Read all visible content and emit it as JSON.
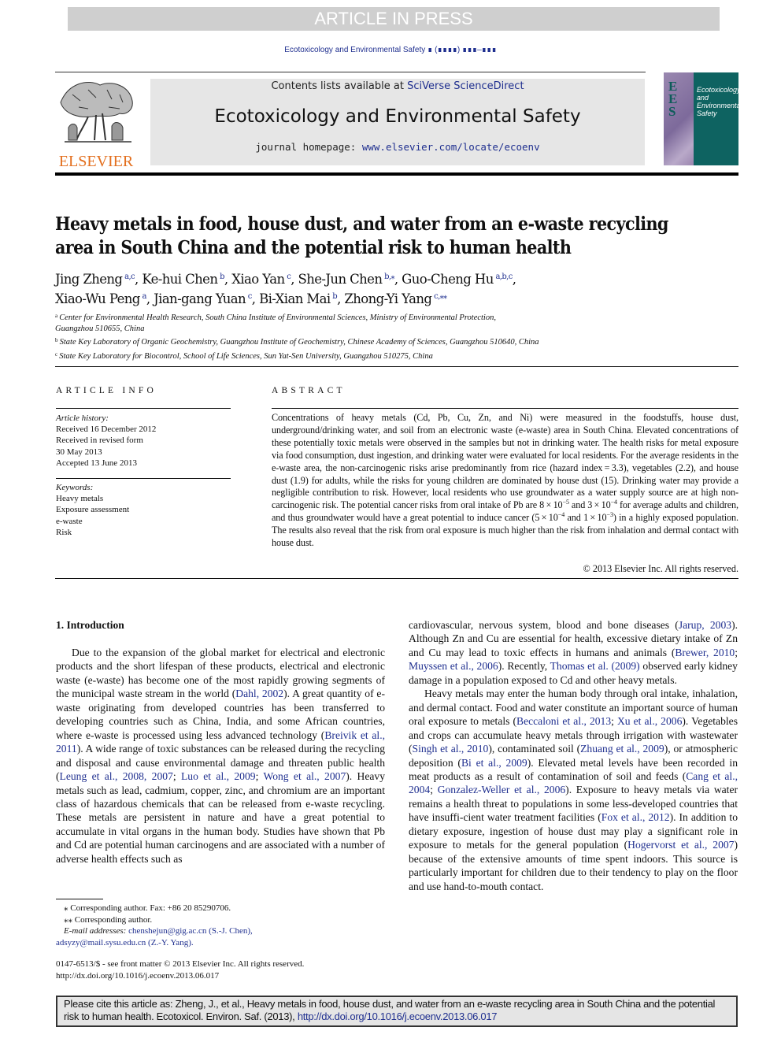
{
  "banner": {
    "text": "ARTICLE IN PRESS"
  },
  "running_head": {
    "text": "Ecotoxicology and Environmental Safety ∎ (∎∎∎∎) ∎∎∎–∎∎∎"
  },
  "publisher": {
    "wordmark": "ELSEVIER"
  },
  "masthead": {
    "contents_prefix": "Contents lists available at ",
    "contents_link": "SciVerse ScienceDirect",
    "journal_title": "Ecotoxicology and Environmental Safety",
    "homepage_prefix": "journal homepage: ",
    "homepage_link": "www.elsevier.com/locate/ecoenv"
  },
  "cover": {
    "letters": [
      "E",
      "E",
      "S"
    ],
    "title_lines": [
      "Ecotoxicology",
      "and",
      "Environmental",
      "Safety"
    ]
  },
  "article": {
    "title_line1": "Heavy metals in food, house dust, and water from an e-waste recycling",
    "title_line2": "area in South China and the potential risk to human health",
    "authors": [
      {
        "name": "Jing Zheng",
        "aff": "a,c"
      },
      {
        "name": "Ke-hui Chen",
        "aff": "b"
      },
      {
        "name": "Xiao Yan",
        "aff": "c"
      },
      {
        "name": "She-Jun Chen",
        "aff": "b,⁎"
      },
      {
        "name": "Guo-Cheng Hu",
        "aff": "a,b,c"
      },
      {
        "name": "Xiao-Wu Peng",
        "aff": "a"
      },
      {
        "name": "Jian-gang Yuan",
        "aff": "c"
      },
      {
        "name": "Bi-Xian Mai",
        "aff": "b"
      },
      {
        "name": "Zhong-Yi Yang",
        "aff": "c,⁎⁎"
      }
    ],
    "affiliations": [
      {
        "key": "a",
        "text_line1": "Center for Environmental Health Research, South China Institute of Environmental Sciences, Ministry of Environmental Protection,",
        "text_line2": "Guangzhou 510655, China"
      },
      {
        "key": "b",
        "text_line1": "State Key Laboratory of Organic Geochemistry, Guangzhou Institute of Geochemistry, Chinese Academy of Sciences, Guangzhou 510640, China"
      },
      {
        "key": "c",
        "text_line1": "State Key Laboratory for Biocontrol, School of Life Sciences, Sun Yat-Sen University, Guangzhou 510275, China"
      }
    ]
  },
  "article_info": {
    "heading": "ARTICLE INFO",
    "history_label": "Article history:",
    "history": [
      "Received 16 December 2012",
      "Received in revised form",
      "30 May 2013",
      "Accepted 13 June 2013"
    ],
    "keywords_label": "Keywords:",
    "keywords": [
      "Heavy metals",
      "Exposure assessment",
      "e-waste",
      "Risk"
    ]
  },
  "abstract": {
    "heading": "ABSTRACT",
    "part1": "Concentrations of heavy metals (Cd, Pb, Cu, Zn, and Ni) were measured in the foodstuffs, house dust, underground/drinking water, and soil from an electronic waste (e-waste) area in South China. Elevated concentrations of these potentially toxic metals were observed in the samples but not in drinking water. The health risks for metal exposure via food consumption, dust ingestion, and drinking water were evaluated for local residents. For the average residents in the e-waste area, the non-carcinogenic risks arise predominantly from rice (hazard index = 3.3), vegetables (2.2), and house dust (1.9) for adults, while the risks for young children are dominated by house dust (15). Drinking water may provide a negligible contribution to risk. However, local residents who use groundwater as a water supply source are at high non-carcinogenic risk. The potential cancer risks from oral intake of Pb are 8 × 10",
    "exp1": "−5",
    "part2": " and 3 × 10",
    "exp2": "−4",
    "part3": " for average adults and children, and thus groundwater would have a great potential to induce cancer (5 × 10",
    "exp3": "−4",
    "part4": " and 1 × 10",
    "exp4": "−3",
    "part5": ") in a highly exposed population. The results also reveal that the risk from oral exposure is much higher than the risk from inhalation and dermal contact with house dust.",
    "copyright": "© 2013 Elsevier Inc. All rights reserved."
  },
  "intro": {
    "heading": "1.  Introduction",
    "left_p1": [
      {
        "t": "Due to the expansion of the global market for electrical and electronic products and the short lifespan of these products, electrical and electronic waste (e-waste) has become one of the most rapidly growing segments of the municipal waste stream in the world ("
      },
      {
        "l": "Dahl, 2002"
      },
      {
        "t": "). A great quantity of e-waste originating from developed countries has been transferred to developing countries such as China, India, and some African countries, where e-waste is processed using less advanced technology ("
      },
      {
        "l": "Breivik et al., 2011"
      },
      {
        "t": "). A wide range of toxic substances can be released during the recycling and disposal and cause environmental damage and threaten public health ("
      },
      {
        "l": "Leung et al., 2008, 2007"
      },
      {
        "t": "; "
      },
      {
        "l": "Luo et al., 2009"
      },
      {
        "t": "; "
      },
      {
        "l": "Wong et al., 2007"
      },
      {
        "t": "). Heavy metals such as lead, cadmium, copper, zinc, and chromium are an important class of hazardous chemicals that can be released from e-waste recycling. These metals are persistent in nature and have a great potential to accumulate in vital organs in the human body. Studies have shown that Pb and Cd are potential human carcinogens and are associated with a number of adverse health effects such as"
      }
    ],
    "right_p1": [
      {
        "t": "cardiovascular, nervous system, blood and bone diseases ("
      },
      {
        "l": "Jarup, 2003"
      },
      {
        "t": "). Although Zn and Cu are essential for health, excessive dietary intake of Zn and Cu may lead to toxic effects in humans and animals ("
      },
      {
        "l": "Brewer, 2010"
      },
      {
        "t": "; "
      },
      {
        "l": "Muyssen et al., 2006"
      },
      {
        "t": "). Recently, "
      },
      {
        "l": "Thomas et al. (2009)"
      },
      {
        "t": " observed early kidney damage in a population exposed to Cd and other heavy metals."
      }
    ],
    "right_p2": [
      {
        "t": "Heavy metals may enter the human body through oral intake, inhalation, and dermal contact. Food and water constitute an important source of human oral exposure to metals ("
      },
      {
        "l": "Beccaloni et al., 2013"
      },
      {
        "t": "; "
      },
      {
        "l": "Xu et al., 2006"
      },
      {
        "t": "). Vegetables and crops can accumulate heavy metals through irrigation with wastewater ("
      },
      {
        "l": "Singh et al., 2010"
      },
      {
        "t": "), contaminated soil ("
      },
      {
        "l": "Zhuang et al., 2009"
      },
      {
        "t": "), or atmospheric deposition ("
      },
      {
        "l": "Bi et al., 2009"
      },
      {
        "t": "). Elevated metal levels have been recorded in meat products as a result of contamination of soil and feeds ("
      },
      {
        "l": "Cang et al., 2004"
      },
      {
        "t": "; "
      },
      {
        "l": "Gonzalez-Weller et al., 2006"
      },
      {
        "t": "). Exposure to heavy metals via water remains a health threat to populations in some less-developed countries that have insuffi-cient water treatment facilities ("
      },
      {
        "l": "Fox et al., 2012"
      },
      {
        "t": "). In addition to dietary exposure, ingestion of house dust may play a significant role in exposure to metals for the general population ("
      },
      {
        "l": "Hogervorst et al., 2007"
      },
      {
        "t": ") because of the extensive amounts of time spent indoors. This source is particularly important for children due to their tendency to play on the floor and use hand-to-mouth contact."
      }
    ]
  },
  "footnotes": {
    "corr1": "⁎ Corresponding author. Fax: +86 20 85290706.",
    "corr2": "⁎⁎ Corresponding author.",
    "email_label": "E-mail addresses: ",
    "email1": "chenshejun@gig.ac.cn (S.-J. Chen),",
    "email2": "adsyzy@mail.sysu.edu.cn (Z.-Y. Yang).",
    "issn": "0147-6513/$ - see front matter © 2013 Elsevier Inc. All rights reserved.",
    "doi": "http://dx.doi.org/10.1016/j.ecoenv.2013.06.017"
  },
  "citation_box": {
    "text": "Please cite this article as: Zheng, J., et al., Heavy metals in food, house dust, and water from an e-waste recycling area in South China and the potential risk to human health. Ecotoxicol. Environ. Saf. (2013), ",
    "doi_link": "http://dx.doi.org/10.1016/j.ecoenv.2013.06.017"
  },
  "colors": {
    "link": "#1f2f8f",
    "elsevier_orange": "#e36f1e",
    "banner_gray": "#cfcfcf",
    "masthead_gray": "#e6e6e6",
    "cover_teal": "#0e6361"
  }
}
